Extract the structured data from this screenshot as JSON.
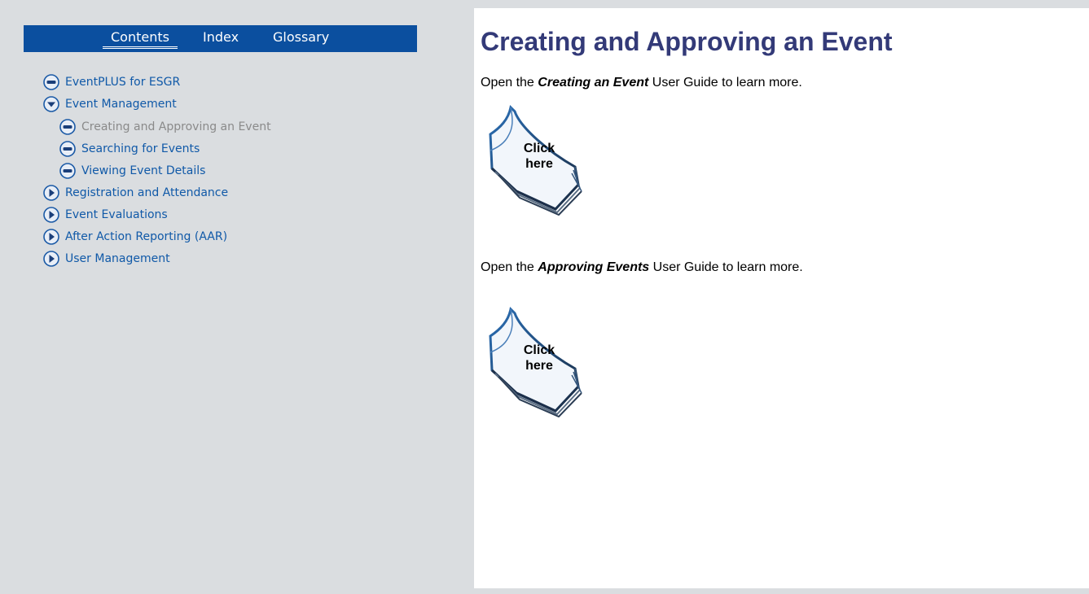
{
  "tabs": {
    "contents": "Contents",
    "index": "Index",
    "glossary": "Glossary"
  },
  "toc": [
    {
      "label": "EventPLUS for ESGR",
      "icon": "minus-circle-icon"
    },
    {
      "label": "Event Management",
      "icon": "chevron-down-circle-icon"
    },
    {
      "label": "Creating and Approving an Event",
      "icon": "minus-circle-icon",
      "current": true
    },
    {
      "label": "Searching for Events",
      "icon": "minus-circle-icon"
    },
    {
      "label": "Viewing Event Details",
      "icon": "minus-circle-icon"
    },
    {
      "label": "Registration and Attendance",
      "icon": "play-circle-icon"
    },
    {
      "label": "Event Evaluations",
      "icon": "play-circle-icon"
    },
    {
      "label": "After Action Reporting (AAR)",
      "icon": "play-circle-icon"
    },
    {
      "label": "User Management",
      "icon": "play-circle-icon"
    }
  ],
  "content": {
    "title": "Creating and Approving an Event",
    "para1": {
      "pre": "Open the ",
      "bold": "Creating an Event",
      "post": " User Guide to learn more."
    },
    "para2": {
      "pre": "Open the ",
      "bold": "Approving Events",
      "post": " User Guide to learn more."
    },
    "book_label": "Click here"
  },
  "colors": {
    "tab_bar": "#0b4f9f",
    "link": "#1059a8",
    "current": "#8a8a8a",
    "title": "#333a78",
    "sidebar_bg": "#dadde0"
  }
}
